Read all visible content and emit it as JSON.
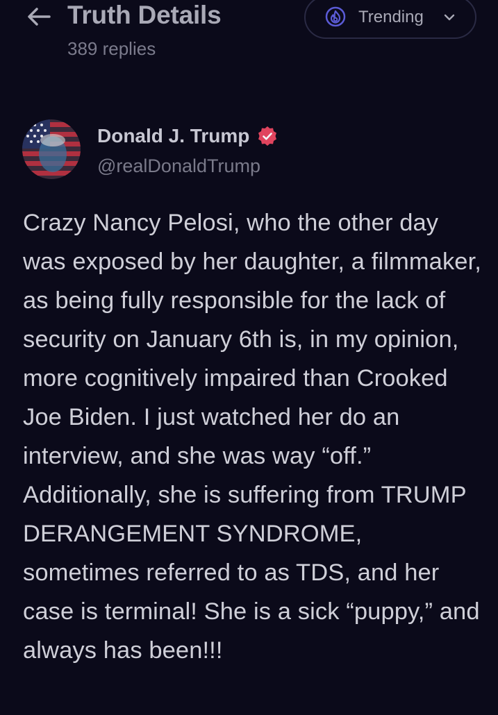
{
  "header": {
    "title": "Truth Details",
    "subtitle": "389 replies",
    "back_icon": "arrow-left-icon",
    "trending": {
      "label": "Trending",
      "icon": "fire-icon",
      "chevron_icon": "chevron-down-icon"
    }
  },
  "post": {
    "author": {
      "name": "Donald J. Trump",
      "handle": "@realDonaldTrump",
      "verified_icon": "verified-badge-icon",
      "verified_color": "#e0445e"
    },
    "text": "Crazy Nancy Pelosi, who the other day was exposed by her daughter, a filmmaker, as being fully responsible for the lack of security on January 6th is, in my opinion, more cognitively impaired than Crooked Joe Biden. I just watched her do an interview, and she was way “off.” Additionally, she is suffering from TRUMP DERANGEMENT SYNDROME, sometimes referred to as TDS, and her case is terminal! She is a sick “puppy,” and always has been!!!"
  },
  "colors": {
    "background": "#0b0a1a",
    "accent": "#5b5bd6",
    "text_primary": "#cfcfd8",
    "text_secondary": "#7b7b8c"
  }
}
